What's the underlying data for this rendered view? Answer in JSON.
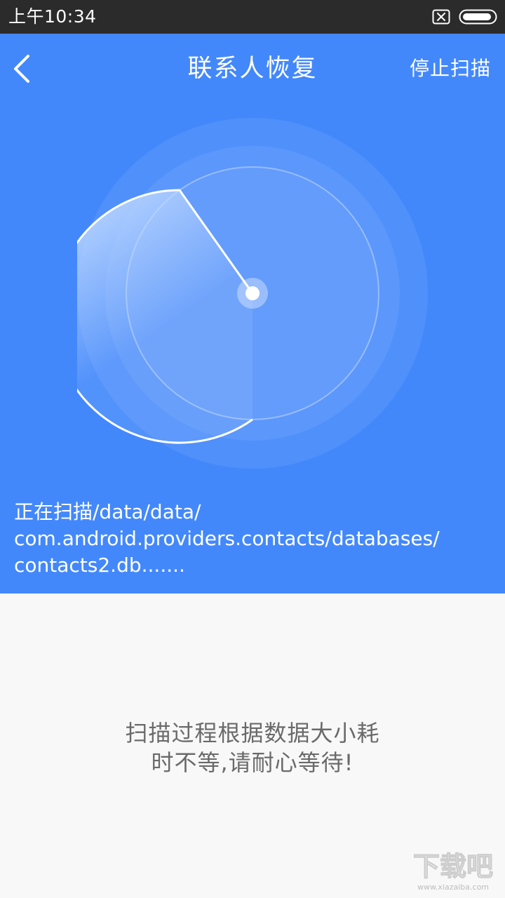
{
  "status_bar": {
    "time": "上午10:34",
    "icons": [
      "notification-x-icon",
      "battery-icon"
    ]
  },
  "header": {
    "back_icon": "chevron-left-icon",
    "title": "联系人恢复",
    "stop_label": "停止扫描"
  },
  "scan": {
    "line1": "正在扫描/data/data/",
    "line2": "com.android.providers.contacts/databases/",
    "line3": "contacts2.db......."
  },
  "hint": {
    "line1": "扫描过程根据数据大小耗",
    "line2": "时不等,请耐心等待!"
  },
  "watermark": {
    "text": "下载吧",
    "subtext": "www.xiazaiba.com"
  },
  "colors": {
    "header_blue": "#4388fb",
    "status_bar": "#2b2b2b",
    "body_bg": "#f8f8f8",
    "hint_text": "#6a6a6a"
  }
}
